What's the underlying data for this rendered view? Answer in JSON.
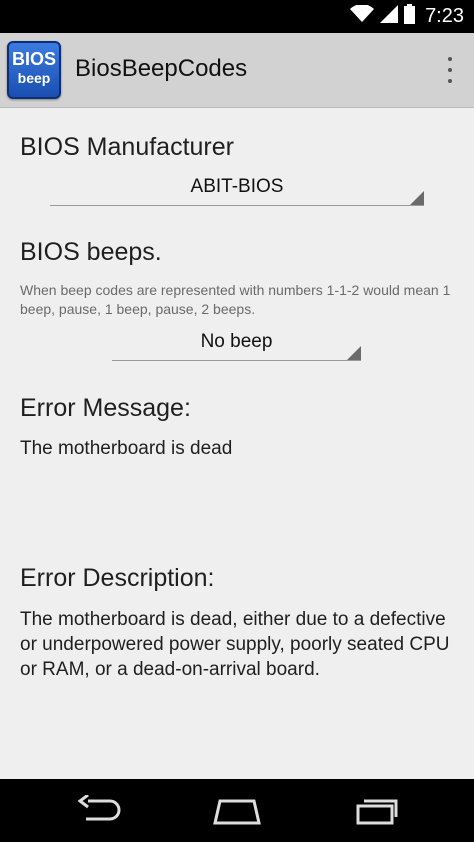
{
  "status_bar": {
    "time": "7:23",
    "icons": [
      "wifi-icon",
      "signal-icon",
      "battery-icon"
    ]
  },
  "action_bar": {
    "app_icon_line1": "BIOS",
    "app_icon_line2": "beep",
    "title": "BiosBeepCodes",
    "menu_icon": "overflow-menu-icon"
  },
  "manufacturer": {
    "label": "BIOS Manufacturer",
    "selected": "ABIT-BIOS"
  },
  "beeps": {
    "label": "BIOS beeps.",
    "help": "When beep codes are represented with numbers 1-1-2 would mean 1 beep, pause, 1 beep, pause, 2 beeps.",
    "selected": "No beep"
  },
  "error_message": {
    "label": "Error Message:",
    "text": "The motherboard is dead"
  },
  "error_description": {
    "label": "Error Description:",
    "text": "The motherboard is dead, either due to a defective or underpowered power supply, poorly seated CPU or RAM, or a dead-on-arrival board."
  },
  "nav_bar": {
    "buttons": [
      "back-icon",
      "home-icon",
      "recents-icon"
    ]
  },
  "colors": {
    "status_bar": "#000000",
    "action_bar": "#d2d2d2",
    "background": "#efefef",
    "app_icon": "#2a63c8"
  }
}
